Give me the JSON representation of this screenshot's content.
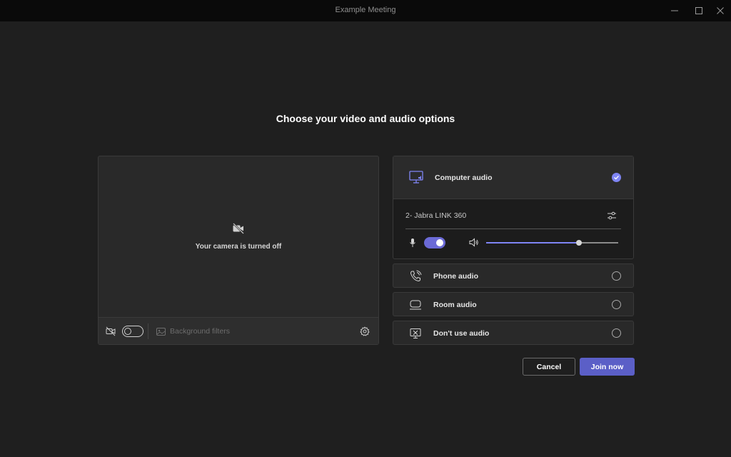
{
  "window": {
    "title": "Example Meeting"
  },
  "heading": "Choose your video and audio options",
  "video": {
    "status_message": "Your camera is turned off",
    "camera_toggle_on": false,
    "background_filters_label": "Background filters"
  },
  "audio": {
    "computer_audio": {
      "label": "Computer audio",
      "selected": true,
      "device_name": "2- Jabra LINK 360",
      "mic_on": true,
      "volume_percent": 70
    },
    "options": [
      {
        "label": "Phone audio",
        "icon": "phone-audio-icon",
        "selected": false
      },
      {
        "label": "Room audio",
        "icon": "room-audio-icon",
        "selected": false
      },
      {
        "label": "Don't use audio",
        "icon": "no-audio-icon",
        "selected": false
      }
    ]
  },
  "buttons": {
    "cancel": "Cancel",
    "join": "Join now"
  },
  "colors": {
    "accent": "#5b5fc7",
    "accent_light": "#7f85f5",
    "background": "#1f1f1f"
  }
}
